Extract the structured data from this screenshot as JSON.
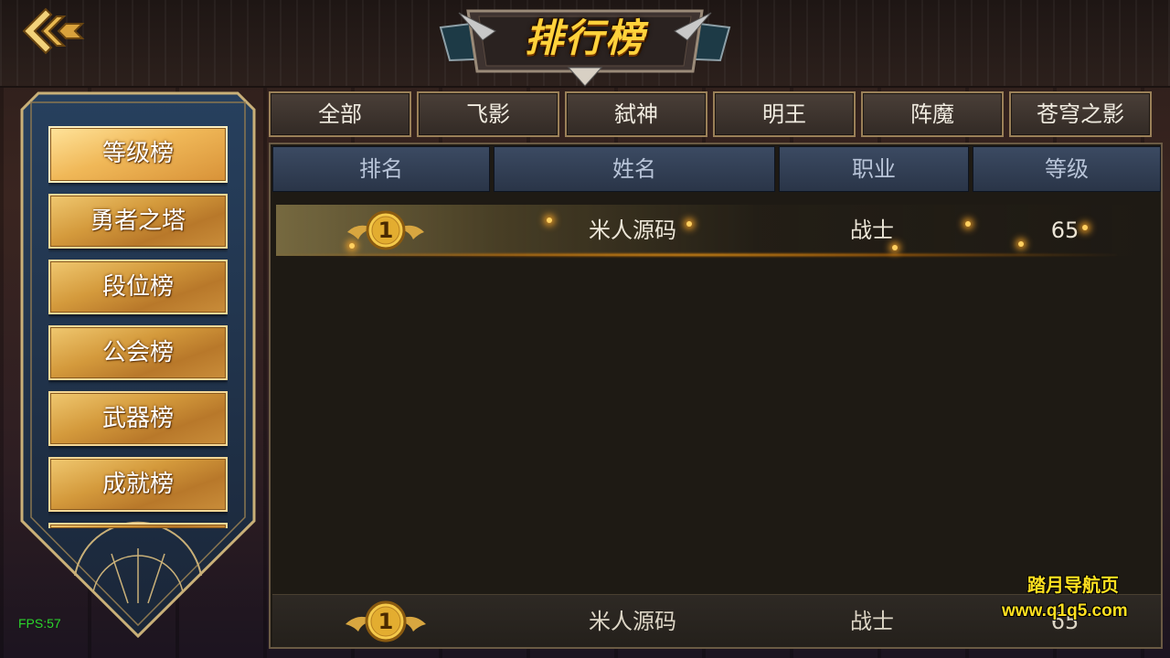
{
  "header": {
    "title": "排行榜"
  },
  "sidebar": {
    "items": [
      {
        "label": "等级榜",
        "active": true
      },
      {
        "label": "勇者之塔",
        "active": false
      },
      {
        "label": "段位榜",
        "active": false
      },
      {
        "label": "公会榜",
        "active": false
      },
      {
        "label": "武器榜",
        "active": false
      },
      {
        "label": "成就榜",
        "active": false
      }
    ]
  },
  "tabs": [
    {
      "label": "全部"
    },
    {
      "label": "飞影"
    },
    {
      "label": "弑神"
    },
    {
      "label": "明王"
    },
    {
      "label": "阵魔"
    },
    {
      "label": "苍穹之影"
    }
  ],
  "table": {
    "headers": [
      "排名",
      "姓名",
      "职业",
      "等级"
    ],
    "rows": [
      {
        "rank": "1",
        "name": "米人源码",
        "class": "战士",
        "level": "65"
      }
    ],
    "my_rank": {
      "rank": "1",
      "name": "米人源码",
      "class": "战士",
      "level": "65"
    }
  },
  "debug": {
    "fps": "FPS:57"
  },
  "watermark": {
    "line1": "踏月导航页",
    "line2": "www.q1q5.com"
  },
  "colors": {
    "accent_gold": "#ffd23c",
    "header_blue": "#3b4a62",
    "fps_green": "#2bd62b"
  }
}
